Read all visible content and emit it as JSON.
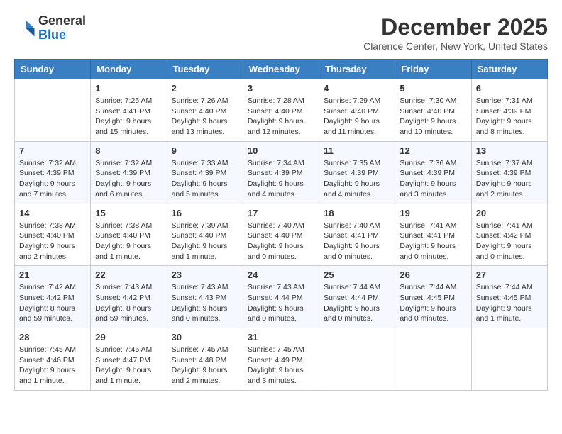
{
  "header": {
    "logo": {
      "general": "General",
      "blue": "Blue"
    },
    "title": "December 2025",
    "location": "Clarence Center, New York, United States"
  },
  "weekdays": [
    "Sunday",
    "Monday",
    "Tuesday",
    "Wednesday",
    "Thursday",
    "Friday",
    "Saturday"
  ],
  "weeks": [
    [
      {
        "day": "",
        "sunrise": "",
        "sunset": "",
        "daylight": ""
      },
      {
        "day": "1",
        "sunrise": "Sunrise: 7:25 AM",
        "sunset": "Sunset: 4:41 PM",
        "daylight": "Daylight: 9 hours and 15 minutes."
      },
      {
        "day": "2",
        "sunrise": "Sunrise: 7:26 AM",
        "sunset": "Sunset: 4:40 PM",
        "daylight": "Daylight: 9 hours and 13 minutes."
      },
      {
        "day": "3",
        "sunrise": "Sunrise: 7:28 AM",
        "sunset": "Sunset: 4:40 PM",
        "daylight": "Daylight: 9 hours and 12 minutes."
      },
      {
        "day": "4",
        "sunrise": "Sunrise: 7:29 AM",
        "sunset": "Sunset: 4:40 PM",
        "daylight": "Daylight: 9 hours and 11 minutes."
      },
      {
        "day": "5",
        "sunrise": "Sunrise: 7:30 AM",
        "sunset": "Sunset: 4:40 PM",
        "daylight": "Daylight: 9 hours and 10 minutes."
      },
      {
        "day": "6",
        "sunrise": "Sunrise: 7:31 AM",
        "sunset": "Sunset: 4:39 PM",
        "daylight": "Daylight: 9 hours and 8 minutes."
      }
    ],
    [
      {
        "day": "7",
        "sunrise": "Sunrise: 7:32 AM",
        "sunset": "Sunset: 4:39 PM",
        "daylight": "Daylight: 9 hours and 7 minutes."
      },
      {
        "day": "8",
        "sunrise": "Sunrise: 7:32 AM",
        "sunset": "Sunset: 4:39 PM",
        "daylight": "Daylight: 9 hours and 6 minutes."
      },
      {
        "day": "9",
        "sunrise": "Sunrise: 7:33 AM",
        "sunset": "Sunset: 4:39 PM",
        "daylight": "Daylight: 9 hours and 5 minutes."
      },
      {
        "day": "10",
        "sunrise": "Sunrise: 7:34 AM",
        "sunset": "Sunset: 4:39 PM",
        "daylight": "Daylight: 9 hours and 4 minutes."
      },
      {
        "day": "11",
        "sunrise": "Sunrise: 7:35 AM",
        "sunset": "Sunset: 4:39 PM",
        "daylight": "Daylight: 9 hours and 4 minutes."
      },
      {
        "day": "12",
        "sunrise": "Sunrise: 7:36 AM",
        "sunset": "Sunset: 4:39 PM",
        "daylight": "Daylight: 9 hours and 3 minutes."
      },
      {
        "day": "13",
        "sunrise": "Sunrise: 7:37 AM",
        "sunset": "Sunset: 4:39 PM",
        "daylight": "Daylight: 9 hours and 2 minutes."
      }
    ],
    [
      {
        "day": "14",
        "sunrise": "Sunrise: 7:38 AM",
        "sunset": "Sunset: 4:40 PM",
        "daylight": "Daylight: 9 hours and 2 minutes."
      },
      {
        "day": "15",
        "sunrise": "Sunrise: 7:38 AM",
        "sunset": "Sunset: 4:40 PM",
        "daylight": "Daylight: 9 hours and 1 minute."
      },
      {
        "day": "16",
        "sunrise": "Sunrise: 7:39 AM",
        "sunset": "Sunset: 4:40 PM",
        "daylight": "Daylight: 9 hours and 1 minute."
      },
      {
        "day": "17",
        "sunrise": "Sunrise: 7:40 AM",
        "sunset": "Sunset: 4:40 PM",
        "daylight": "Daylight: 9 hours and 0 minutes."
      },
      {
        "day": "18",
        "sunrise": "Sunrise: 7:40 AM",
        "sunset": "Sunset: 4:41 PM",
        "daylight": "Daylight: 9 hours and 0 minutes."
      },
      {
        "day": "19",
        "sunrise": "Sunrise: 7:41 AM",
        "sunset": "Sunset: 4:41 PM",
        "daylight": "Daylight: 9 hours and 0 minutes."
      },
      {
        "day": "20",
        "sunrise": "Sunrise: 7:41 AM",
        "sunset": "Sunset: 4:42 PM",
        "daylight": "Daylight: 9 hours and 0 minutes."
      }
    ],
    [
      {
        "day": "21",
        "sunrise": "Sunrise: 7:42 AM",
        "sunset": "Sunset: 4:42 PM",
        "daylight": "Daylight: 8 hours and 59 minutes."
      },
      {
        "day": "22",
        "sunrise": "Sunrise: 7:43 AM",
        "sunset": "Sunset: 4:42 PM",
        "daylight": "Daylight: 8 hours and 59 minutes."
      },
      {
        "day": "23",
        "sunrise": "Sunrise: 7:43 AM",
        "sunset": "Sunset: 4:43 PM",
        "daylight": "Daylight: 9 hours and 0 minutes."
      },
      {
        "day": "24",
        "sunrise": "Sunrise: 7:43 AM",
        "sunset": "Sunset: 4:44 PM",
        "daylight": "Daylight: 9 hours and 0 minutes."
      },
      {
        "day": "25",
        "sunrise": "Sunrise: 7:44 AM",
        "sunset": "Sunset: 4:44 PM",
        "daylight": "Daylight: 9 hours and 0 minutes."
      },
      {
        "day": "26",
        "sunrise": "Sunrise: 7:44 AM",
        "sunset": "Sunset: 4:45 PM",
        "daylight": "Daylight: 9 hours and 0 minutes."
      },
      {
        "day": "27",
        "sunrise": "Sunrise: 7:44 AM",
        "sunset": "Sunset: 4:45 PM",
        "daylight": "Daylight: 9 hours and 1 minute."
      }
    ],
    [
      {
        "day": "28",
        "sunrise": "Sunrise: 7:45 AM",
        "sunset": "Sunset: 4:46 PM",
        "daylight": "Daylight: 9 hours and 1 minute."
      },
      {
        "day": "29",
        "sunrise": "Sunrise: 7:45 AM",
        "sunset": "Sunset: 4:47 PM",
        "daylight": "Daylight: 9 hours and 1 minute."
      },
      {
        "day": "30",
        "sunrise": "Sunrise: 7:45 AM",
        "sunset": "Sunset: 4:48 PM",
        "daylight": "Daylight: 9 hours and 2 minutes."
      },
      {
        "day": "31",
        "sunrise": "Sunrise: 7:45 AM",
        "sunset": "Sunset: 4:49 PM",
        "daylight": "Daylight: 9 hours and 3 minutes."
      },
      {
        "day": "",
        "sunrise": "",
        "sunset": "",
        "daylight": ""
      },
      {
        "day": "",
        "sunrise": "",
        "sunset": "",
        "daylight": ""
      },
      {
        "day": "",
        "sunrise": "",
        "sunset": "",
        "daylight": ""
      }
    ]
  ]
}
